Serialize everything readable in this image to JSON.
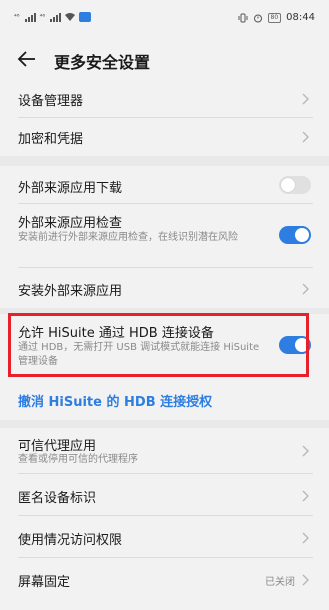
{
  "status_bar": {
    "signal1": "⁴⁶",
    "signal2": "⁴⁶",
    "time": "08:44",
    "battery": "80"
  },
  "header": {
    "title": "更多安全设置"
  },
  "items": {
    "device_manager": {
      "label": "设备管理器"
    },
    "encryption": {
      "label": "加密和凭据"
    },
    "external_download": {
      "label": "外部来源应用下载",
      "toggle": false
    },
    "external_check": {
      "label": "外部来源应用检查",
      "subtitle": "安装前进行外部来源应用检查，在线识别潜在风险",
      "toggle": true
    },
    "install_external": {
      "label": "安装外部来源应用"
    },
    "hisuite_hdb": {
      "label": "允许 HiSuite 通过 HDB 连接设备",
      "subtitle": "通过 HDB，无需打开 USB 调试模式就能连接 HiSuite 管理设备",
      "toggle": true
    },
    "revoke_link": {
      "label": "撤消 HiSuite 的 HDB 连接授权"
    },
    "trust_agents": {
      "label": "可信代理应用",
      "subtitle": "查看或停用可信的代理程序"
    },
    "anonymous_id": {
      "label": "匿名设备标识"
    },
    "usage_access": {
      "label": "使用情况访问权限"
    },
    "screen_pinning": {
      "label": "屏幕固定",
      "value": "已关闭"
    }
  },
  "colors": {
    "accent": "#2e7de1",
    "highlight": "#e8202a"
  }
}
